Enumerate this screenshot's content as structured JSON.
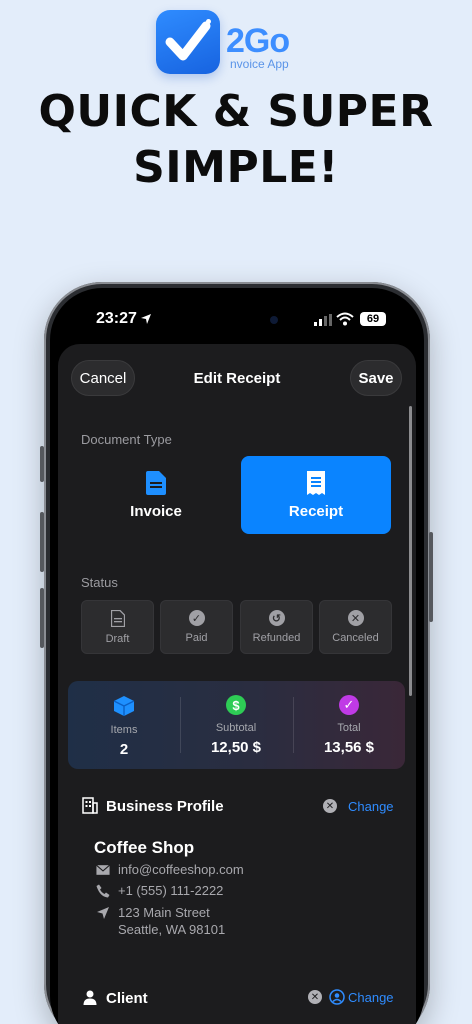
{
  "marketing": {
    "logo_main": "2Go",
    "logo_sub": "nvoice App",
    "headline_line1": "QUICK & SUPER",
    "headline_line2": "SIMPLE!"
  },
  "status_bar": {
    "time": "23:27",
    "battery": "69"
  },
  "nav": {
    "cancel_label": "Cancel",
    "title": "Edit Receipt",
    "save_label": "Save"
  },
  "document_type": {
    "label": "Document Type",
    "options": [
      {
        "label": "Invoice",
        "icon": "document-icon",
        "selected": false
      },
      {
        "label": "Receipt",
        "icon": "receipt-icon",
        "selected": true
      }
    ]
  },
  "status": {
    "label": "Status",
    "options": [
      {
        "label": "Draft",
        "icon": "draft-icon"
      },
      {
        "label": "Paid",
        "icon": "checkmark-icon"
      },
      {
        "label": "Refunded",
        "icon": "refund-icon"
      },
      {
        "label": "Canceled",
        "icon": "cancel-icon"
      }
    ]
  },
  "summary": {
    "items": {
      "label": "Items",
      "value": "2",
      "icon_color": "#1e90ff"
    },
    "subtotal": {
      "label": "Subtotal",
      "value": "12,50 $",
      "icon_color": "#2ecc55"
    },
    "total": {
      "label": "Total",
      "value": "13,56 $",
      "icon_color": "#c03ae6"
    }
  },
  "business_profile": {
    "title": "Business Profile",
    "change_label": "Change",
    "name": "Coffee Shop",
    "email": "info@coffeeshop.com",
    "phone": "+1 (555) 111-2222",
    "address_line1": "123 Main Street",
    "address_line2": "Seattle, WA 98101"
  },
  "client": {
    "title": "Client",
    "change_label": "Change"
  },
  "colors": {
    "accent": "#0a84ff",
    "background": "#e3edfa",
    "sheet": "#1c1c1e"
  }
}
